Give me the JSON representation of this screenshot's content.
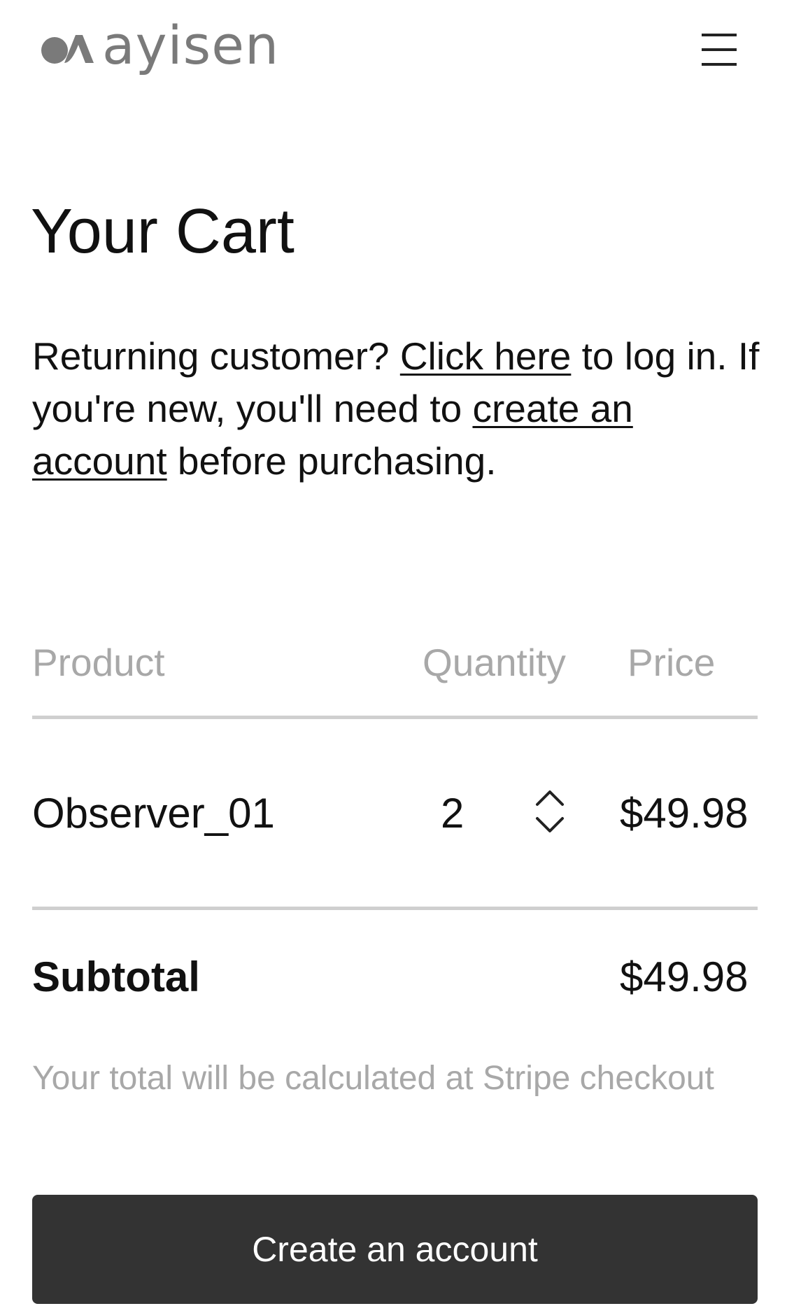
{
  "header": {
    "logo_text": "ayisen",
    "logo_mark_icon": "ayisen-logo-mark",
    "menu_icon": "hamburger-menu-icon"
  },
  "page": {
    "title": "Your Cart"
  },
  "intro": {
    "text_before_login": "Returning customer? ",
    "login_link": "Click here",
    "text_between": " to log in. If you're new, you'll need to ",
    "create_account_link": "create an account",
    "text_after": " before purchasing."
  },
  "table": {
    "headers": {
      "product": "Product",
      "quantity": "Quantity",
      "price": "Price"
    },
    "rows": [
      {
        "product": "Observer_01",
        "quantity": "2",
        "price": "$49.98",
        "stepper_up_icon": "chevron-up-icon",
        "stepper_down_icon": "chevron-down-icon"
      }
    ]
  },
  "summary": {
    "subtotal_label": "Subtotal",
    "subtotal_value": "$49.98",
    "note": "Your total will be calculated at Stripe checkout"
  },
  "cta": {
    "label": "Create an account"
  },
  "colors": {
    "text": "#111111",
    "muted": "#a8a8a8",
    "rule": "#cfcfcf",
    "logo": "#7a7a7a",
    "button_bg": "#333333",
    "button_text": "#ffffff"
  }
}
